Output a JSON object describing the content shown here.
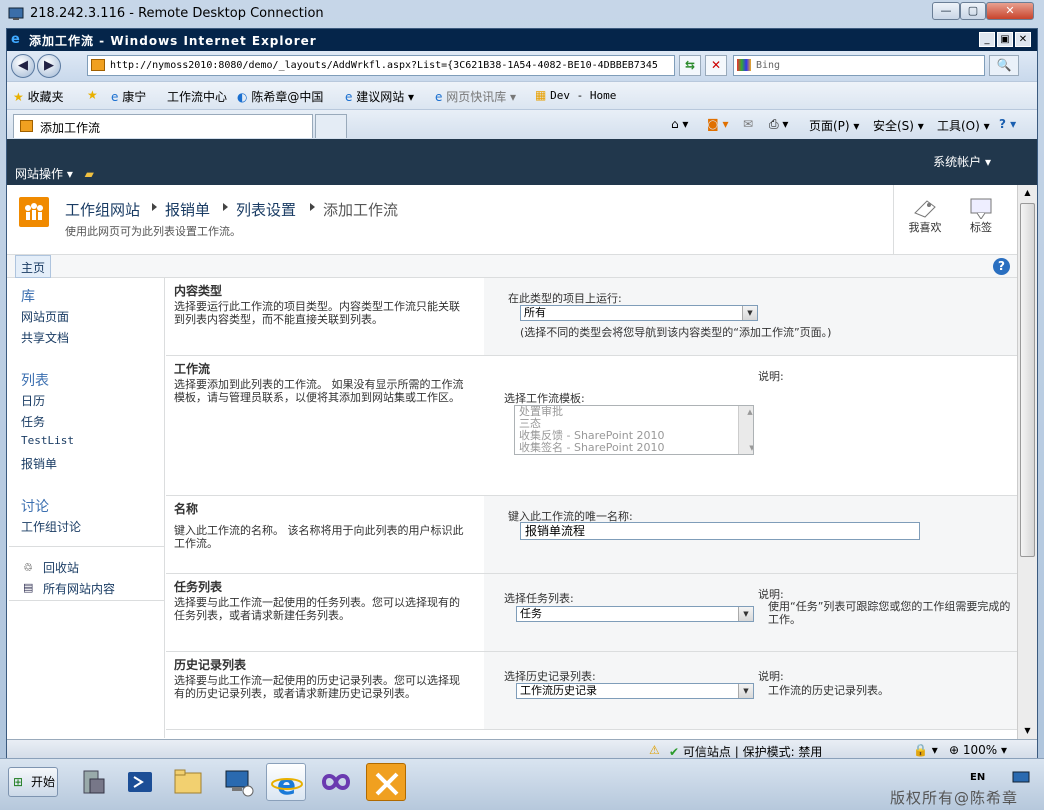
{
  "rdp": {
    "title": "218.242.3.116 - Remote Desktop Connection"
  },
  "ie": {
    "title": "添加工作流 - Windows Internet Explorer",
    "address": "http://nymoss2010:8080/demo/_layouts/AddWrkfl.aspx?List={3C621B38-1A54-4082-BE10-4DBBEB7345",
    "search_placeholder": "Bing",
    "favorites": {
      "label": "收藏夹",
      "items": [
        "康宁",
        "工作流中心",
        "陈希章@中国",
        "建议网站",
        "网页快讯库",
        "Dev - Home"
      ]
    },
    "tab": "添加工作流",
    "commands": {
      "page": "页面(P)",
      "safety": "安全(S)",
      "tools": "工具(O)"
    },
    "status": {
      "trusted": "可信站点",
      "protected": "保护模式: 禁用",
      "zoom": "100%"
    }
  },
  "sp": {
    "site_actions": "网站操作",
    "account": "系统帐户",
    "breadcrumb": [
      "工作组网站",
      "报销单",
      "列表设置",
      "添加工作流"
    ],
    "subtitle": "使用此网页可为此列表设置工作流。",
    "social": {
      "like": "我喜欢",
      "tags": "标签"
    },
    "home_tab": "主页",
    "quicklaunch": {
      "libraries": "库",
      "site_pages": "网站页面",
      "shared_docs": "共享文档",
      "lists": "列表",
      "calendar": "日历",
      "tasks": "任务",
      "testlist": "TestList",
      "expense": "报销单",
      "discussions": "讨论",
      "team_discussion": "工作组讨论",
      "recycle": "回收站",
      "all_content": "所有网站内容"
    },
    "sections": {
      "content_type": {
        "title": "内容类型",
        "desc": "选择要运行此工作流的项目类型。内容类型工作流只能关联到列表内容类型，而不能直接关联到列表。",
        "label": "在此类型的项目上运行:",
        "value": "所有",
        "note": "(选择不同的类型会将您导航到该内容类型的“添加工作流”页面。)"
      },
      "workflow": {
        "title": "工作流",
        "desc": "选择要添加到此列表的工作流。 如果没有显示所需的工作流模板，请与管理员联系，以便将其添加到网站集或工作区。",
        "label": "选择工作流模板:",
        "desc_label": "说明:",
        "templates": [
          "处置审批",
          "三态",
          "收集反馈 - SharePoint 2010",
          "收集签名 - SharePoint 2010"
        ]
      },
      "name": {
        "title": "名称",
        "desc": "键入此工作流的名称。 该名称将用于向此列表的用户标识此工作流。",
        "label": "键入此工作流的唯一名称:",
        "value": "报销单流程"
      },
      "task_list": {
        "title": "任务列表",
        "desc": "选择要与此工作流一起使用的任务列表。您可以选择现有的任务列表，或者请求新建任务列表。",
        "label": "选择任务列表:",
        "value": "任务",
        "desc_label": "说明:",
        "desc_text": "使用“任务”列表可跟踪您或您的工作组需要完成的工作。"
      },
      "history_list": {
        "title": "历史记录列表",
        "desc": "选择要与此工作流一起使用的历史记录列表。您可以选择现有的历史记录列表，或者请求新建历史记录列表。",
        "label": "选择历史记录列表:",
        "value": "工作流历史记录",
        "desc_label": "说明:",
        "desc_text": "工作流的历史记录列表。"
      }
    }
  },
  "taskbar": {
    "start": "开始",
    "lang": "EN",
    "watermark": "版权所有@陈希章"
  }
}
